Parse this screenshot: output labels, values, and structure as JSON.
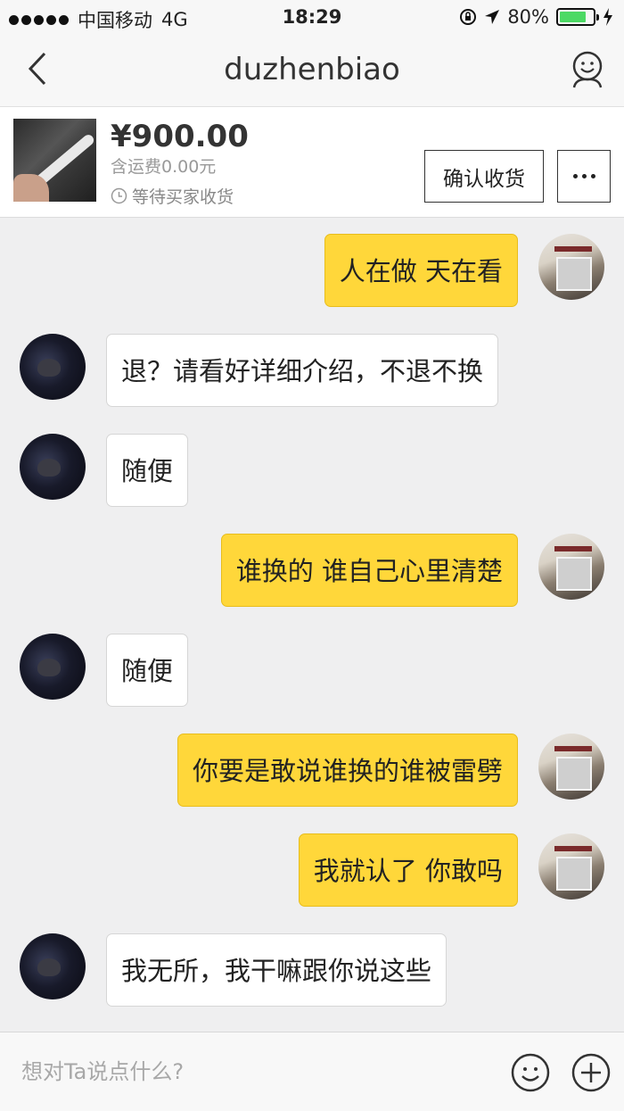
{
  "status_bar": {
    "carrier": "中国移动",
    "network": "4G",
    "time": "18:29",
    "battery_percent": "80%",
    "battery_level": 0.8
  },
  "nav": {
    "title": "duzhenbiao",
    "back_icon": "chevron-left-icon",
    "profile_icon": "user-icon"
  },
  "product": {
    "price": "¥900.00",
    "shipping": "含运费0.00元",
    "status": "等待买家收货",
    "confirm_label": "确认收货",
    "more_icon": "more-dots-icon"
  },
  "messages": [
    {
      "side": "out",
      "text": "人在做 天在看"
    },
    {
      "side": "in",
      "text": "退？请看好详细介绍，不退不换"
    },
    {
      "side": "in",
      "text": "随便"
    },
    {
      "side": "out",
      "text": "谁换的 谁自己心里清楚"
    },
    {
      "side": "in",
      "text": "随便"
    },
    {
      "side": "out",
      "text": "你要是敢说谁换的谁被雷劈"
    },
    {
      "side": "out",
      "text": "我就认了 你敢吗"
    },
    {
      "side": "in",
      "text": "我无所，我干嘛跟你说这些"
    }
  ],
  "input_bar": {
    "placeholder": "想对Ta说点什么?",
    "emoji_icon": "smiley-icon",
    "plus_icon": "plus-circle-icon"
  },
  "colors": {
    "outgoing_bubble": "#ffd73a",
    "incoming_bubble": "#ffffff",
    "chat_background": "#efeff0"
  }
}
